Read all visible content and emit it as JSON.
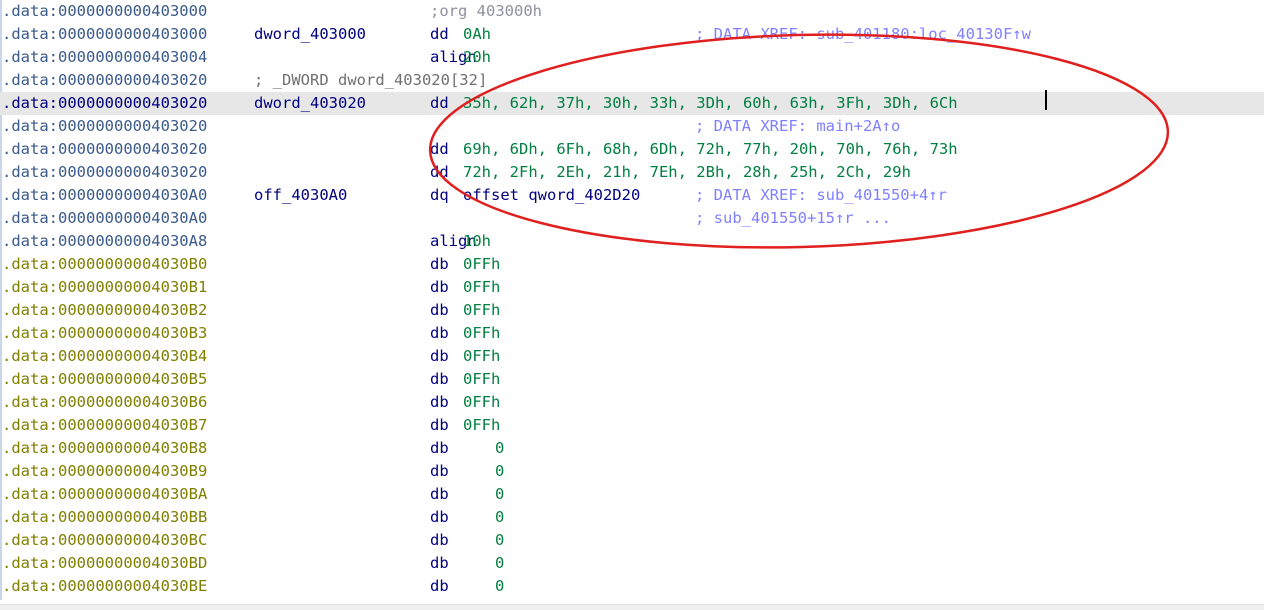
{
  "disassembly": {
    "lines": [
      {
        "addr": ".data:0000000000403000",
        "label": "",
        "mnem": ";org 403000h",
        "op": "",
        "cmt": ""
      },
      {
        "addr": ".data:0000000000403000",
        "label": "dword_403000",
        "mnem": "dd",
        "op": "0Ah",
        "cmt": "; DATA XREF: sub_401180:loc_40130F↑w"
      },
      {
        "addr": ".data:0000000000403004",
        "label": "",
        "mnem": "align",
        "op": "20h",
        "cmt": ""
      },
      {
        "addr": ".data:0000000000403020",
        "label": "; _DWORD dword_403020[32]",
        "mnem": "",
        "op": "",
        "cmt": ""
      },
      {
        "addr": ".data:0000000000403020",
        "label": "dword_403020",
        "mnem": "dd",
        "op": "35h, 62h, 37h, 30h, 33h, 3Dh, 60h, 63h, 3Fh, 3Dh, 6Ch",
        "cmt": ""
      },
      {
        "addr": ".data:0000000000403020",
        "label": "",
        "mnem": "",
        "op": "",
        "cmt": "; DATA XREF: main+2A↑o"
      },
      {
        "addr": ".data:0000000000403020",
        "label": "",
        "mnem": "dd",
        "op": "69h, 6Dh, 6Fh, 68h, 6Dh, 72h, 77h, 20h, 70h, 76h, 73h",
        "cmt": ""
      },
      {
        "addr": ".data:0000000000403020",
        "label": "",
        "mnem": "dd",
        "op": "72h, 2Fh, 2Eh, 21h, 7Eh, 2Bh, 28h, 25h, 2Ch, 29h",
        "cmt": ""
      },
      {
        "addr": ".data:00000000004030A0",
        "label": "off_4030A0",
        "mnem": "dq",
        "op": "offset qword_402D20",
        "cmt": "; DATA XREF: sub_401550+4↑r"
      },
      {
        "addr": ".data:00000000004030A0",
        "label": "",
        "mnem": "",
        "op": "",
        "cmt": "; sub_401550+15↑r ..."
      },
      {
        "addr": ".data:00000000004030A8",
        "label": "",
        "mnem": "align",
        "op": "10h",
        "cmt": ""
      },
      {
        "addr": ".data:00000000004030B0",
        "label": "",
        "mnem": "db",
        "op": "0FFh",
        "cmt": ""
      },
      {
        "addr": ".data:00000000004030B1",
        "label": "",
        "mnem": "db",
        "op": "0FFh",
        "cmt": ""
      },
      {
        "addr": ".data:00000000004030B2",
        "label": "",
        "mnem": "db",
        "op": "0FFh",
        "cmt": ""
      },
      {
        "addr": ".data:00000000004030B3",
        "label": "",
        "mnem": "db",
        "op": "0FFh",
        "cmt": ""
      },
      {
        "addr": ".data:00000000004030B4",
        "label": "",
        "mnem": "db",
        "op": "0FFh",
        "cmt": ""
      },
      {
        "addr": ".data:00000000004030B5",
        "label": "",
        "mnem": "db",
        "op": "0FFh",
        "cmt": ""
      },
      {
        "addr": ".data:00000000004030B6",
        "label": "",
        "mnem": "db",
        "op": "0FFh",
        "cmt": ""
      },
      {
        "addr": ".data:00000000004030B7",
        "label": "",
        "mnem": "db",
        "op": "0FFh",
        "cmt": ""
      },
      {
        "addr": ".data:00000000004030B8",
        "label": "",
        "mnem": "db",
        "op": "0",
        "cmt": ""
      },
      {
        "addr": ".data:00000000004030B9",
        "label": "",
        "mnem": "db",
        "op": "0",
        "cmt": ""
      },
      {
        "addr": ".data:00000000004030BA",
        "label": "",
        "mnem": "db",
        "op": "0",
        "cmt": ""
      },
      {
        "addr": ".data:00000000004030BB",
        "label": "",
        "mnem": "db",
        "op": "0",
        "cmt": ""
      },
      {
        "addr": ".data:00000000004030BC",
        "label": "",
        "mnem": "db",
        "op": "0",
        "cmt": ""
      },
      {
        "addr": ".data:00000000004030BD",
        "label": "",
        "mnem": "db",
        "op": "0",
        "cmt": ""
      },
      {
        "addr": ".data:00000000004030BE",
        "label": "",
        "mnem": "db",
        "op": "0",
        "cmt": ""
      }
    ]
  },
  "colors": {
    "address_header": "#3a5a8a",
    "address_data": "#7f7f00",
    "label": "#000080",
    "operand_value": "#007f40",
    "comment": "#8080ff",
    "selected_line_bg": "#e7e7e7",
    "annotation_circle": "#e0201f"
  }
}
